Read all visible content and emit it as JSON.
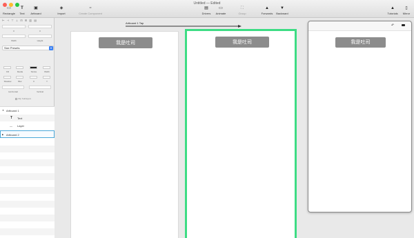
{
  "window": {
    "title": "Untitled — Edited"
  },
  "toolbar": {
    "rectangle": "Rectangle",
    "text": "Text",
    "artboard": "Artboard",
    "import": "Import",
    "create_component": "Create Component",
    "drivers": "Drivers",
    "animate": "Animate",
    "group": "Group",
    "forwards": "Forwards",
    "backward": "Backward",
    "tutorials": "Tutorials",
    "mirror": "Mirror"
  },
  "inspector": {
    "x": "0",
    "y": "0",
    "width_label": "Width",
    "height_label": "Height",
    "size_presets": "Size Presets",
    "fill": "Fill",
    "media": "Media",
    "stroke": "Stroke",
    "width": "Width",
    "shadow": "Shadow",
    "blur": "Blur",
    "sx": "X",
    "sy": "Y",
    "horizontal": "Horizontal",
    "vertical": "Vertical",
    "clip_sublayers": "Clip Sublayers"
  },
  "layers": [
    {
      "label": "Artboard 1",
      "indent": 0,
      "icon": "▼"
    },
    {
      "label": "Text",
      "indent": 1,
      "icon": "T"
    },
    {
      "label": "Layer",
      "indent": 1,
      "icon": "—"
    },
    {
      "label": "Artboard 2",
      "indent": 0,
      "icon": "▶"
    }
  ],
  "canvas": {
    "connector_label": "Artboard 1 Tap",
    "button_label": "我是吐司"
  },
  "preview": {
    "button_label": "我是吐司"
  },
  "colors": {
    "selection_green": "#3ddc84",
    "button_gray": "#8c8c8c"
  }
}
